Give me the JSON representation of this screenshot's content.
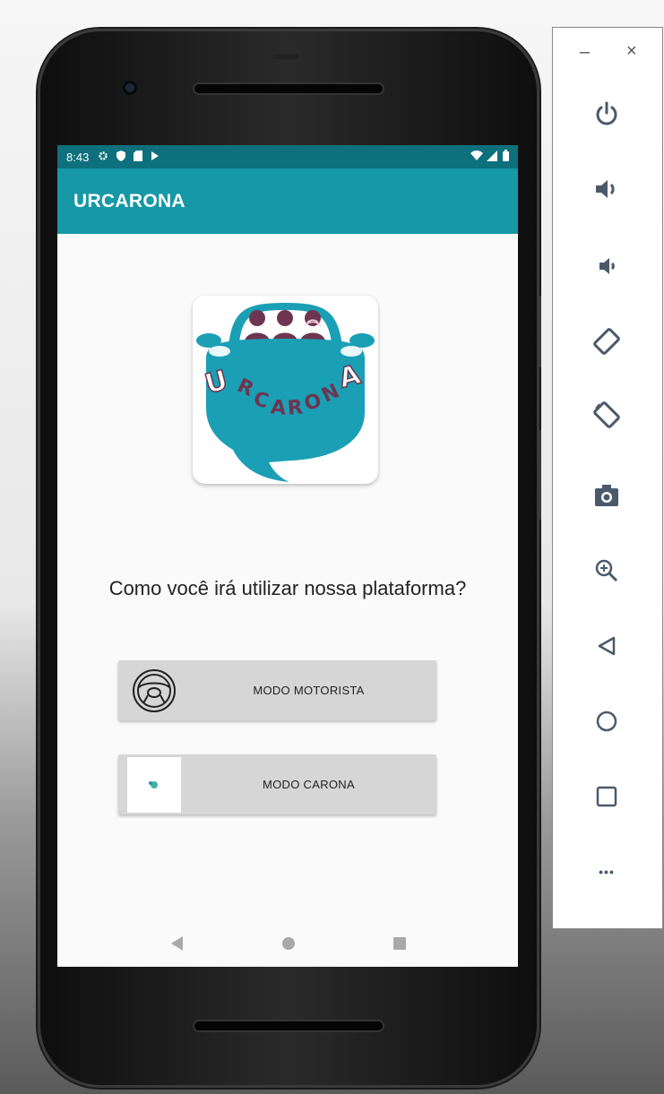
{
  "statusbar": {
    "time": "8:43",
    "left_icons": [
      "gear-icon",
      "shield-icon",
      "sd-card-icon",
      "play-icon"
    ],
    "right_icons": [
      "wifi-icon",
      "signal-icon",
      "battery-icon"
    ]
  },
  "appbar": {
    "title": "URCARONA"
  },
  "logo": {
    "text": "URCARONA",
    "color_primary": "#1a9fb5",
    "color_people": "#6e3550"
  },
  "main": {
    "question": "Como você irá utilizar nossa plataforma?",
    "buttons": [
      {
        "label": "MODO MOTORISTA",
        "icon": "steering-wheel-icon"
      },
      {
        "label": "MODO CARONA",
        "icon": "passenger-icon"
      }
    ]
  },
  "navbar": {
    "items": [
      "back-icon",
      "home-icon",
      "recents-icon"
    ]
  },
  "emulator_panel": {
    "window_controls": {
      "minimize": "–",
      "close": "×"
    },
    "tools": [
      "power-icon",
      "volume-up-icon",
      "volume-down-icon",
      "rotate-left-icon",
      "rotate-right-icon",
      "camera-icon",
      "zoom-icon",
      "back-icon",
      "home-icon",
      "overview-icon",
      "more-icon"
    ],
    "more_label": "•••"
  },
  "colors": {
    "status_bar": "#0d707c",
    "app_bar": "#1698a6",
    "button_bg": "#d6d6d6"
  }
}
